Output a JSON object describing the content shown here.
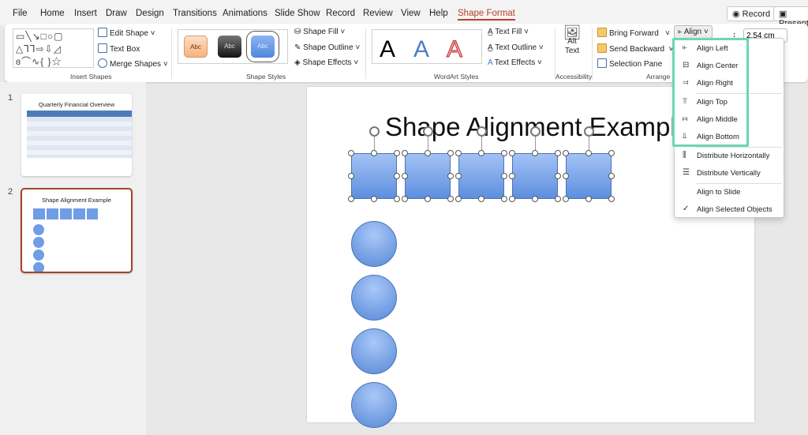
{
  "tabs": [
    "File",
    "Home",
    "Insert",
    "Draw",
    "Design",
    "Transitions",
    "Animations",
    "Slide Show",
    "Record",
    "Review",
    "View",
    "Help",
    "Shape Format"
  ],
  "active_tab": "Shape Format",
  "top_buttons": {
    "record": "Record",
    "present": "Present"
  },
  "ribbon": {
    "insert_shapes": {
      "label": "Insert Shapes",
      "edit_shape": "Edit Shape",
      "text_box": "Text Box",
      "merge_shapes": "Merge Shapes"
    },
    "shape_styles": {
      "label": "Shape Styles",
      "presets": [
        "Abc",
        "Abc",
        "Abc"
      ],
      "shape_fill": "Shape Fill",
      "shape_outline": "Shape Outline",
      "shape_effects": "Shape Effects"
    },
    "wordart": {
      "label": "WordArt Styles",
      "presets": [
        "A",
        "A",
        "A"
      ],
      "text_fill": "Text Fill",
      "text_outline": "Text Outline",
      "text_effects": "Text Effects"
    },
    "accessibility": {
      "label": "Accessibility",
      "alt_text_1": "Alt",
      "alt_text_2": "Text"
    },
    "arrange": {
      "label": "Arrange",
      "bring_forward": "Bring Forward",
      "send_backward": "Send Backward",
      "selection_pane": "Selection Pane",
      "align": "Align"
    },
    "size": {
      "height": "2.54 cm"
    }
  },
  "align_menu": {
    "items": [
      "Align Left",
      "Align Center",
      "Align Right",
      "Align Top",
      "Align Middle",
      "Align Bottom",
      "Distribute Horizontally",
      "Distribute Vertically",
      "Align to Slide",
      "Align Selected Objects"
    ],
    "checked": "Align Selected Objects",
    "highlight_color": "#6fd6b0"
  },
  "slides": [
    {
      "number": "1",
      "title": "Quarterly Financial Overview"
    },
    {
      "number": "2",
      "title": "Shape Alignment Example",
      "selected": true
    }
  ],
  "slide": {
    "title": "Shape Alignment Example"
  },
  "colors": {
    "accent": "#b5412a",
    "shape_fill": "#6f9de6"
  }
}
